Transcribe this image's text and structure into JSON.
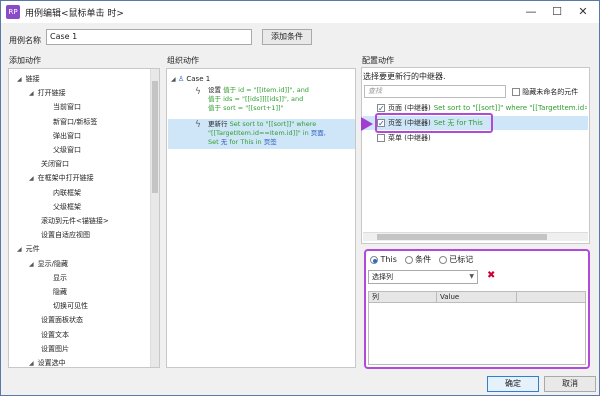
{
  "window": {
    "title": "用例编辑<鼠标单击 时>",
    "app_icon_text": "RP",
    "minimize": "—",
    "maximize": "☐",
    "close": "✕"
  },
  "header": {
    "case_name_label": "用例名称",
    "case_name_value": "Case 1",
    "add_condition_label": "添加条件"
  },
  "sections": {
    "add_action": "添加动作",
    "organize_action": "组织动作",
    "config_action": "配置动作"
  },
  "action_tree": {
    "items": [
      {
        "label": "链接",
        "level": 0,
        "arrow": "◢"
      },
      {
        "label": "打开链接",
        "level": 1,
        "arrow": "◢"
      },
      {
        "label": "当前窗口",
        "level": 3,
        "arrow": ""
      },
      {
        "label": "新窗口/新标签",
        "level": 3,
        "arrow": ""
      },
      {
        "label": "弹出窗口",
        "level": 3,
        "arrow": ""
      },
      {
        "label": "父级窗口",
        "level": 3,
        "arrow": ""
      },
      {
        "label": "关闭窗口",
        "level": 2,
        "arrow": ""
      },
      {
        "label": "在框架中打开链接",
        "level": 1,
        "arrow": "◢"
      },
      {
        "label": "内联框架",
        "level": 3,
        "arrow": ""
      },
      {
        "label": "父级框架",
        "level": 3,
        "arrow": ""
      },
      {
        "label": "滚动到元件<锚链接>",
        "level": 2,
        "arrow": ""
      },
      {
        "label": "设置自适应视图",
        "level": 2,
        "arrow": ""
      },
      {
        "label": "元件",
        "level": 0,
        "arrow": "◢"
      },
      {
        "label": "显示/隐藏",
        "level": 1,
        "arrow": "◢"
      },
      {
        "label": "显示",
        "level": 3,
        "arrow": ""
      },
      {
        "label": "隐藏",
        "level": 3,
        "arrow": ""
      },
      {
        "label": "切换可见性",
        "level": 3,
        "arrow": ""
      },
      {
        "label": "设置面板状态",
        "level": 2,
        "arrow": ""
      },
      {
        "label": "设置文本",
        "level": 2,
        "arrow": ""
      },
      {
        "label": "设置图片",
        "level": 2,
        "arrow": ""
      },
      {
        "label": "设置选中",
        "level": 1,
        "arrow": "◢"
      }
    ]
  },
  "organize": {
    "case_label": "Case 1",
    "action1": {
      "verb": "设置",
      "line1": "值于 id = \"[[Item.id]]\", and",
      "line2": "值于 ids = \"[[ids]][[ids]]\", and",
      "line3": "值于 sort = \"[[sort+1]]\""
    },
    "action2": {
      "verb": "更新行",
      "line1_g": "Set sort to \"[[sort]]\" where",
      "line2_g": "\"[[TargetItem.id==Item.id]]\" in",
      "line2_b": "页面,",
      "line3_g": "Set",
      "line3_b": "无",
      "line3_g2": "for This in",
      "line3_b2": "页签"
    }
  },
  "config": {
    "header": "选择要更新行的中继器.",
    "search_placeholder": "查找",
    "hide_unnamed_label": "隐藏未命名的元件",
    "widgets": [
      {
        "name": "页面 (中继器)",
        "detail": "Set sort to \"[[sort]]\" where \"[[TargetItem.id==Ite",
        "checked": true
      },
      {
        "name": "页签 (中继器)",
        "detail": "Set 无 for This",
        "checked": true
      },
      {
        "name": "菜单 (中继器)",
        "detail": "",
        "checked": false
      }
    ],
    "radio_this": "This",
    "radio_condition": "条件",
    "radio_marked": "已标记",
    "select_column": "选择列",
    "select_arrow": "▼",
    "delete_icon": "✖",
    "table_col1": "列",
    "table_col2": "Value"
  },
  "footer": {
    "ok_label": "确定",
    "cancel_label": "取消"
  },
  "colors": {
    "green": "#2e9e2e",
    "blue": "#2d5fbf",
    "purple_highlight": "#b04ad8",
    "selection": "#cfe6f8"
  }
}
